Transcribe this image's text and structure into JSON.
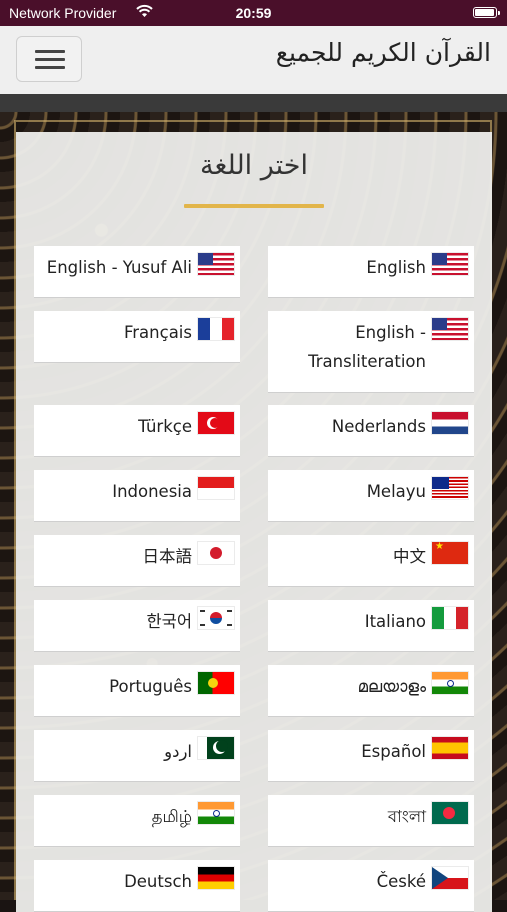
{
  "status_bar": {
    "carrier": "Network Provider",
    "time": "20:59",
    "battery_level": 1.0
  },
  "header": {
    "title": "القرآن الكريم للجميع"
  },
  "panel": {
    "title": "اختر اللغة"
  },
  "languages": [
    {
      "label": "English",
      "flag": "us-flag"
    },
    {
      "label": "English - Yusuf Ali",
      "flag": "us-flag"
    },
    {
      "label": "English - Transliteration",
      "flag": "us-flag"
    },
    {
      "label": "Français",
      "flag": "france-flag"
    },
    {
      "label": "Nederlands",
      "flag": "netherlands-flag"
    },
    {
      "label": "Türkçe",
      "flag": "turkey-flag"
    },
    {
      "label": "Melayu",
      "flag": "malaysia-flag"
    },
    {
      "label": "Indonesia",
      "flag": "indonesia-flag"
    },
    {
      "label": "中文",
      "flag": "china-flag"
    },
    {
      "label": "日本語",
      "flag": "japan-flag"
    },
    {
      "label": "Italiano",
      "flag": "italy-flag"
    },
    {
      "label": "한국어",
      "flag": "korea-flag"
    },
    {
      "label": "മലയാളം",
      "flag": "india-flag"
    },
    {
      "label": "Português",
      "flag": "portugal-flag"
    },
    {
      "label": "Español",
      "flag": "spain-flag"
    },
    {
      "label": "اردو",
      "flag": "pakistan-flag"
    },
    {
      "label": "বাংলা",
      "flag": "bangladesh-flag"
    },
    {
      "label": "தமிழ்",
      "flag": "india-flag"
    },
    {
      "label": "České",
      "flag": "czech-flag"
    },
    {
      "label": "Deutsch",
      "flag": "germany-flag"
    }
  ],
  "colors": {
    "status_bar": "#4a0f2a",
    "accent_underline": "#e2b54a"
  }
}
